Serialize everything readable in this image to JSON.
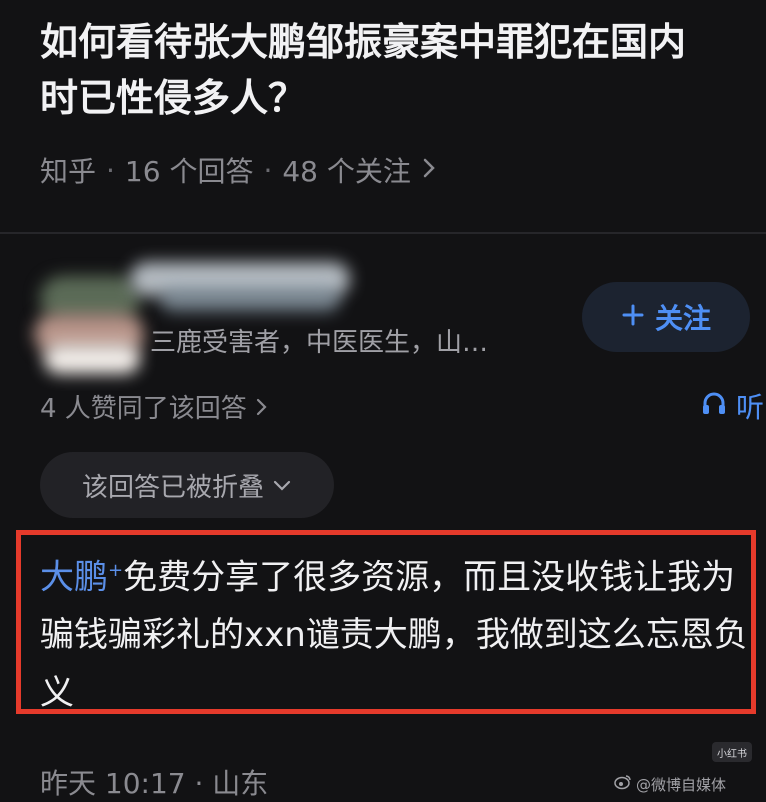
{
  "question": {
    "title_line1": "如何看待张大鹏邹振豪案中罪犯在国内",
    "title_line2": "时已性侵多人？"
  },
  "meta": {
    "source": "知乎",
    "answers": "16 个回答",
    "follows": "48 个关注",
    "chevron_icon": "chevron-right-icon"
  },
  "author": {
    "subtitle": "三鹿受害者，中医医生，山…",
    "follow_label": "关注",
    "plus_icon": "plus-icon"
  },
  "stats": {
    "upvote_text": "4 人赞同了该回答",
    "listen_label": "听",
    "listen_icon": "headphones-icon"
  },
  "fold": {
    "label": "该回答已被折叠"
  },
  "comment": {
    "name": "大鹏",
    "sup": "+",
    "text": "免费分享了很多资源，而且没收钱让我为骗钱骗彩礼的xxn谴责大鹏，我做到这么忘恩负义"
  },
  "footer": {
    "time": "昨天 10:17 · 山东"
  },
  "badge": {
    "label": "小红书"
  },
  "watermark": {
    "text": "@微博自媒体"
  },
  "colors": {
    "accent_blue": "#4e8ff5",
    "highlight_border": "#e53a2b",
    "background": "#121214"
  }
}
